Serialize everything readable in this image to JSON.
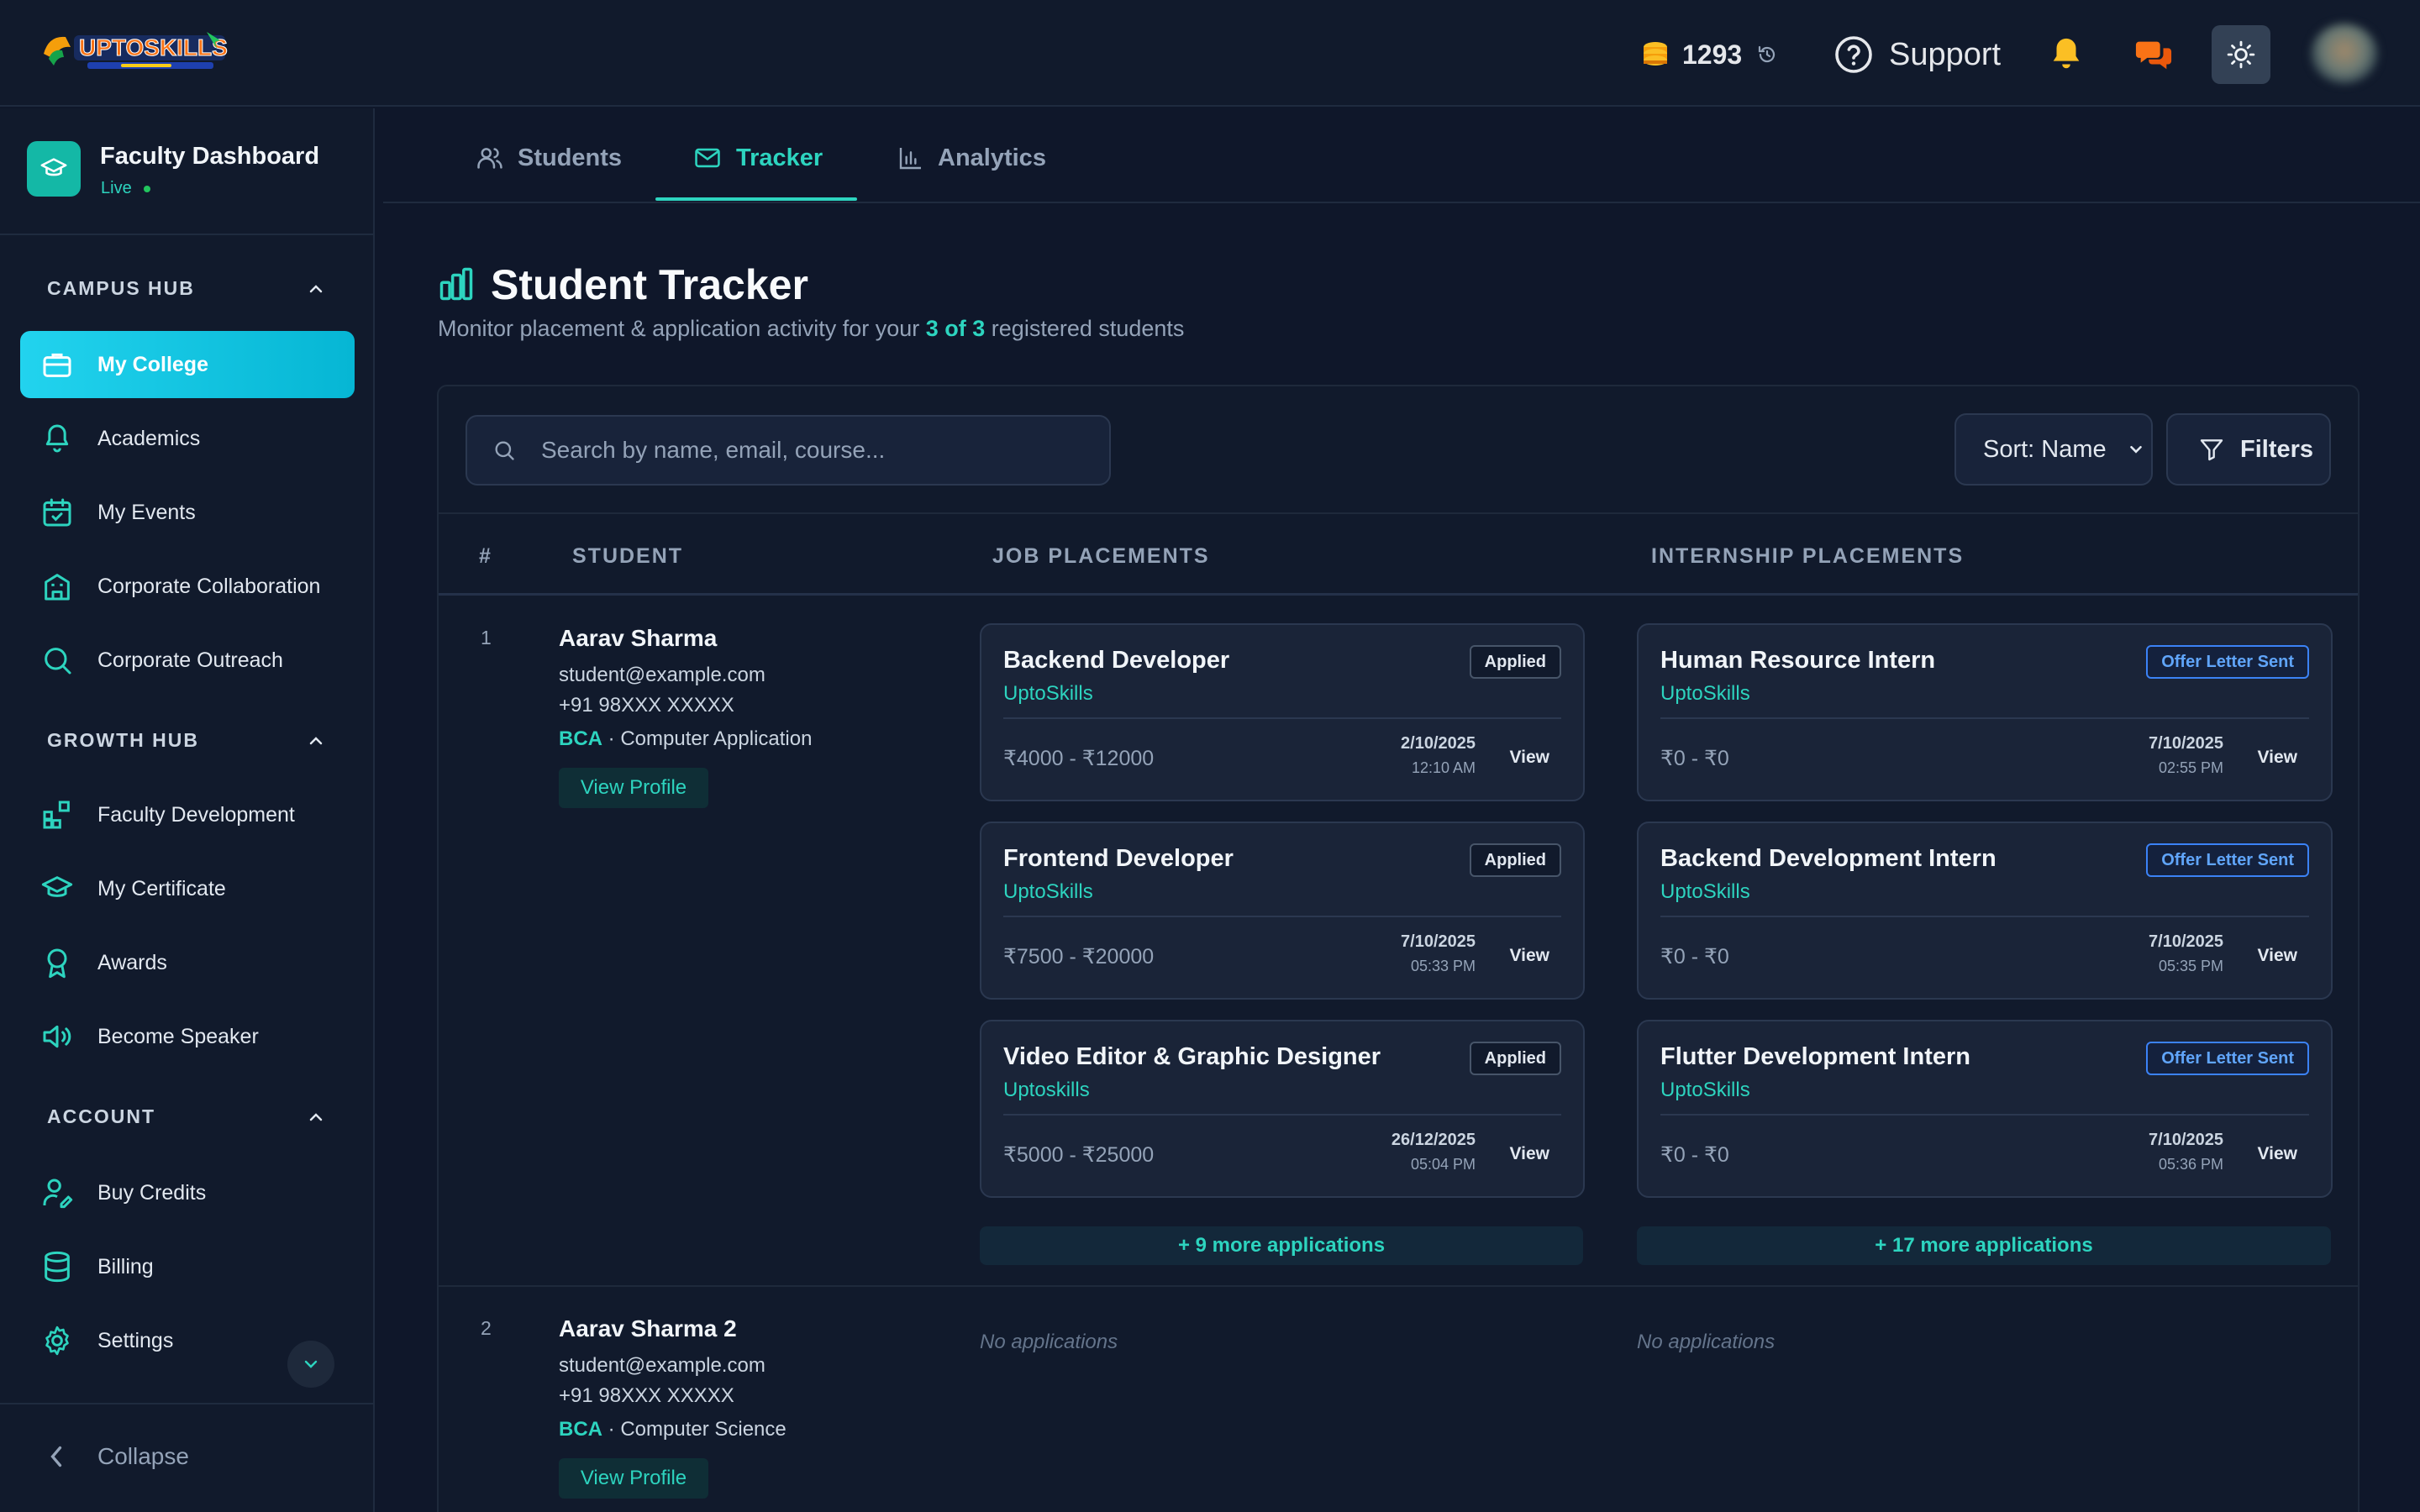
{
  "header": {
    "coins": "1293",
    "support_label": "Support",
    "colors": {
      "accent": "#2dd4bf",
      "active_nav": "#06b6d4",
      "bell": "#fbbf24",
      "chat": "#f97316"
    }
  },
  "sidebar": {
    "title": "Faculty Dashboard",
    "status": "Live",
    "sections": [
      {
        "heading": "CAMPUS HUB",
        "items": [
          "My College",
          "Academics",
          "My Events",
          "Corporate Collaboration",
          "Corporate Outreach"
        ]
      },
      {
        "heading": "GROWTH HUB",
        "items": [
          "Faculty Development",
          "My Certificate",
          "Awards",
          "Become Speaker"
        ]
      },
      {
        "heading": "ACCOUNT",
        "items": [
          "Buy Credits",
          "Billing",
          "Settings"
        ]
      }
    ],
    "collapse_label": "Collapse"
  },
  "tabs": [
    "Students",
    "Tracker",
    "Analytics"
  ],
  "page": {
    "title": "Student Tracker",
    "subtitle_pre": "Monitor placement & application activity for your ",
    "subtitle_hl": "3 of 3",
    "subtitle_post": " registered students"
  },
  "toolbar": {
    "search_placeholder": "Search by name, email, course...",
    "sort_label": "Sort: Name",
    "filters_label": "Filters"
  },
  "table": {
    "headers": [
      "#",
      "STUDENT",
      "JOB PLACEMENTS",
      "INTERNSHIP PLACEMENTS"
    ],
    "rows": [
      {
        "num": "1",
        "name": "Aarav Sharma",
        "email": "student@example.com",
        "phone": "+91 98XXX XXXXX",
        "degree": "BCA",
        "course": " · Computer Application",
        "view_profile": "View Profile",
        "jobs": [
          {
            "title": "Backend Developer",
            "company": "UptoSkills",
            "status": "Applied",
            "salary": "₹4000 - ₹12000",
            "date": "2/10/2025",
            "time": "12:10 AM",
            "view": "View"
          },
          {
            "title": "Frontend Developer",
            "company": "UptoSkills",
            "status": "Applied",
            "salary": "₹7500 - ₹20000",
            "date": "7/10/2025",
            "time": "05:33 PM",
            "view": "View"
          },
          {
            "title": "Video Editor & Graphic Designer",
            "company": "Uptoskills",
            "status": "Applied",
            "salary": "₹5000 - ₹25000",
            "date": "26/12/2025",
            "time": "05:04 PM",
            "view": "View"
          }
        ],
        "jobs_more": "+ 9 more applications",
        "internships": [
          {
            "title": "Human Resource Intern",
            "company": "UptoSkills",
            "status": "Offer Letter Sent",
            "salary": "₹0 - ₹0",
            "date": "7/10/2025",
            "time": "02:55 PM",
            "view": "View"
          },
          {
            "title": "Backend Development Intern",
            "company": "UptoSkills",
            "status": "Offer Letter Sent",
            "salary": "₹0 - ₹0",
            "date": "7/10/2025",
            "time": "05:35 PM",
            "view": "View"
          },
          {
            "title": "Flutter Development Intern",
            "company": "UptoSkills",
            "status": "Offer Letter Sent",
            "salary": "₹0 - ₹0",
            "date": "7/10/2025",
            "time": "05:36 PM",
            "view": "View"
          }
        ],
        "internships_more": "+ 17 more applications"
      },
      {
        "num": "2",
        "name": "Aarav Sharma 2",
        "email": "student@example.com",
        "phone": "+91 98XXX XXXXX",
        "degree": "BCA",
        "course": " · Computer Science",
        "view_profile": "View Profile",
        "jobs_empty": "No applications",
        "internships_empty": "No applications"
      }
    ]
  }
}
